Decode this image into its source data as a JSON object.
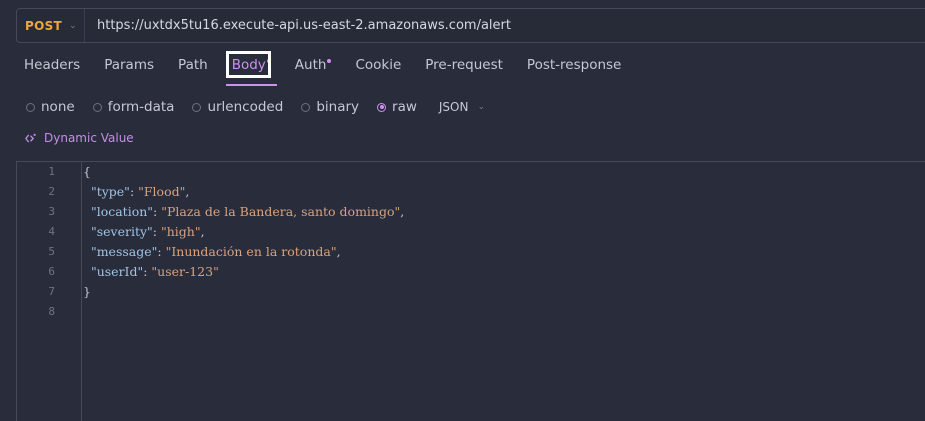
{
  "request": {
    "method": "POST",
    "url": "https://uxtdx5tu16.execute-api.us-east-2.amazonaws.com/alert"
  },
  "tabs": [
    {
      "label": "Headers"
    },
    {
      "label": "Params"
    },
    {
      "label": "Path"
    },
    {
      "label": "Body",
      "active": true,
      "dot": true
    },
    {
      "label": "Auth",
      "dot": true
    },
    {
      "label": "Cookie"
    },
    {
      "label": "Pre-request"
    },
    {
      "label": "Post-response"
    }
  ],
  "body_types": {
    "options": [
      {
        "label": "none",
        "checked": false
      },
      {
        "label": "form-data",
        "checked": false
      },
      {
        "label": "urlencoded",
        "checked": false
      },
      {
        "label": "binary",
        "checked": false
      },
      {
        "label": "raw",
        "checked": true
      }
    ],
    "format": "JSON"
  },
  "dynamic_value": {
    "label": "Dynamic Value"
  },
  "editor": {
    "line_numbers": [
      "1",
      "2",
      "3",
      "4",
      "5",
      "6",
      "7",
      "8"
    ],
    "lines": [
      [
        {
          "t": "p",
          "v": "{"
        }
      ],
      [
        {
          "t": "p",
          "v": "  "
        },
        {
          "t": "k",
          "v": "\"type\""
        },
        {
          "t": "p",
          "v": ": "
        },
        {
          "t": "s",
          "v": "\"Flood\""
        },
        {
          "t": "p",
          "v": ","
        }
      ],
      [
        {
          "t": "p",
          "v": "  "
        },
        {
          "t": "k",
          "v": "\"location\""
        },
        {
          "t": "p",
          "v": ": "
        },
        {
          "t": "s",
          "v": "\"Plaza de la Bandera, santo domingo\""
        },
        {
          "t": "p",
          "v": ","
        }
      ],
      [
        {
          "t": "p",
          "v": "  "
        },
        {
          "t": "k",
          "v": "\"severity\""
        },
        {
          "t": "p",
          "v": ": "
        },
        {
          "t": "s",
          "v": "\"high\""
        },
        {
          "t": "p",
          "v": ","
        }
      ],
      [
        {
          "t": "p",
          "v": "  "
        },
        {
          "t": "k",
          "v": "\"message\""
        },
        {
          "t": "p",
          "v": ": "
        },
        {
          "t": "s",
          "v": "\"Inundación en la rotonda\""
        },
        {
          "t": "p",
          "v": ","
        }
      ],
      [
        {
          "t": "p",
          "v": "  "
        },
        {
          "t": "k",
          "v": "\"userId\""
        },
        {
          "t": "p",
          "v": ": "
        },
        {
          "t": "s",
          "v": "\"user-123\""
        }
      ],
      [
        {
          "t": "p",
          "v": "}"
        }
      ],
      []
    ]
  },
  "colors": {
    "method": "#f0a73a",
    "accent": "#cf8ff0",
    "json_key": "#9fc4e6",
    "json_string": "#d9a27c",
    "background": "#292d3b"
  }
}
